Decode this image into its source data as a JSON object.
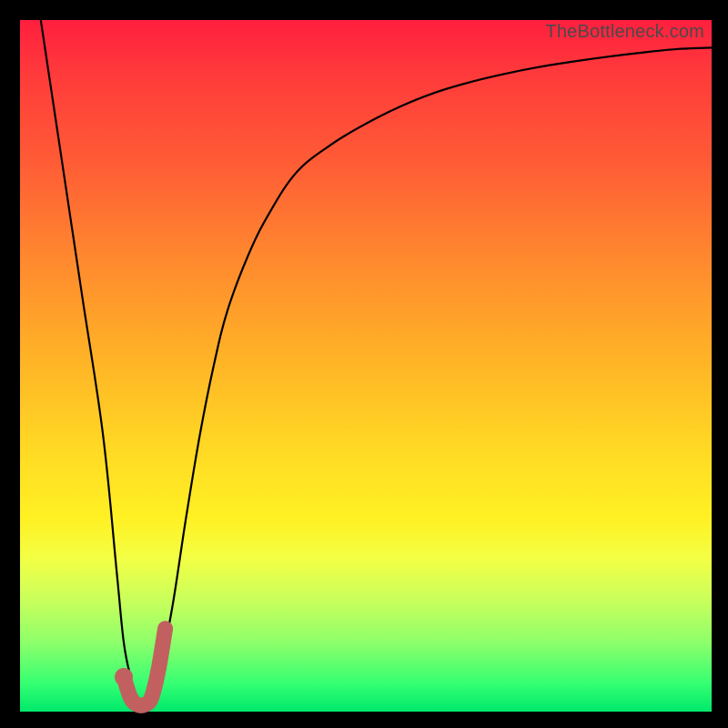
{
  "watermark": "TheBottleneck.com",
  "colors": {
    "curve_main": "#000000",
    "curve_accent": "#c1605f",
    "gradient_top": "#ff1f3f",
    "gradient_bottom": "#00e86b"
  },
  "chart_data": {
    "type": "line",
    "title": "",
    "xlabel": "",
    "ylabel": "",
    "xlim": [
      0,
      100
    ],
    "ylim": [
      0,
      100
    ],
    "series": [
      {
        "name": "bottleneck-curve",
        "x": [
          3,
          6,
          9,
          12,
          14,
          15,
          16,
          17,
          18,
          19,
          20,
          22,
          24,
          26,
          28,
          30,
          33,
          36,
          40,
          45,
          50,
          55,
          60,
          65,
          70,
          75,
          80,
          85,
          90,
          95,
          100
        ],
        "y": [
          100,
          80,
          60,
          40,
          20,
          10,
          5,
          2,
          1,
          2,
          5,
          15,
          28,
          40,
          50,
          58,
          66,
          72,
          78,
          82,
          85,
          87.5,
          89.5,
          91,
          92.2,
          93.2,
          94,
          94.7,
          95.3,
          95.8,
          96
        ]
      },
      {
        "name": "accent-j",
        "x": [
          15,
          16,
          17,
          18,
          19,
          20,
          21
        ],
        "y": [
          5,
          2,
          1,
          1,
          2,
          6,
          12
        ]
      }
    ]
  }
}
